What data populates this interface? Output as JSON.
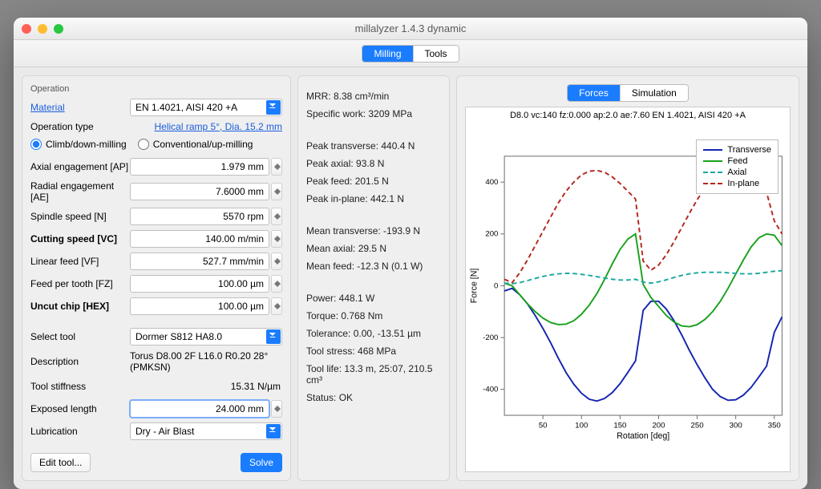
{
  "window": {
    "title": "millalyzer 1.4.3 dynamic"
  },
  "toolbar": {
    "tabs": [
      {
        "label": "Milling",
        "active": true
      },
      {
        "label": "Tools",
        "active": false
      }
    ]
  },
  "right_tabs": [
    {
      "label": "Forces",
      "active": true
    },
    {
      "label": "Simulation",
      "active": false
    }
  ],
  "operation": {
    "section_label": "Operation",
    "material_label": "Material",
    "material_value": "EN 1.4021, AISI 420 +A",
    "op_type_label": "Operation type",
    "op_type_link": "Helical ramp 5°, Dia. 15.2 mm",
    "radio_climb": "Climb/down-milling",
    "radio_conv": "Conventional/up-milling",
    "climb_selected": true,
    "rows": {
      "ap": {
        "label": "Axial engagement [AP]",
        "value": "1.979 mm"
      },
      "ae": {
        "label": "Radial engagement [AE]",
        "value": "7.6000 mm"
      },
      "n": {
        "label": "Spindle speed [N]",
        "value": "5570 rpm"
      },
      "vc": {
        "label": "Cutting speed [VC]",
        "value": "140.00 m/min",
        "bold": true
      },
      "vf": {
        "label": "Linear feed [VF]",
        "value": "527.7 mm/min"
      },
      "fz": {
        "label": "Feed per tooth [FZ]",
        "value": "100.00 µm"
      },
      "hex": {
        "label": "Uncut chip [HEX]",
        "value": "100.00 µm",
        "bold": true
      }
    },
    "tool": {
      "select_label": "Select tool",
      "select_value": "Dormer S812 HA8.0",
      "desc_label": "Description",
      "desc_value": "Torus D8.00 2F L16.0 R0.20 28° (PMKSN)",
      "stiff_label": "Tool stiffness",
      "stiff_value": "15.31 N/µm",
      "exposed_label": "Exposed length",
      "exposed_value": "24.000 mm",
      "lub_label": "Lubrication",
      "lub_value": "Dry - Air Blast"
    },
    "edit_tool_label": "Edit tool...",
    "solve_label": "Solve"
  },
  "results": [
    "MRR: 8.38 cm³/min",
    "Specific work: 3209 MPa",
    "",
    "Peak transverse: 440.4 N",
    "Peak axial: 93.8 N",
    "Peak feed: 201.5 N",
    "Peak in-plane: 442.1 N",
    "",
    "Mean transverse: -193.9 N",
    "Mean axial: 29.5 N",
    "Mean feed: -12.3 N (0.1 W)",
    "",
    "Power: 448.1 W",
    "Torque: 0.768 Nm",
    "Tolerance: 0.00, -13.51 µm",
    "Tool stress: 468 MPa",
    "Tool life: 13.3 m, 25:07, 210.5 cm³",
    "Status: OK"
  ],
  "chart_data": {
    "type": "line",
    "title": "D8.0 vc:140 fz:0.000 ap:2.0 ae:7.60 EN 1.4021, AISI 420 +A",
    "xlabel": "Rotation [deg]",
    "ylabel": "Force [N]",
    "xlim": [
      0,
      360
    ],
    "ylim": [
      -500,
      500
    ],
    "xticks": [
      50,
      100,
      150,
      200,
      250,
      300,
      350
    ],
    "yticks": [
      -400,
      -200,
      0,
      200,
      400
    ],
    "legend": [
      "Transverse",
      "Feed",
      "Axial",
      "In-plane"
    ],
    "legend_pos": "top-right",
    "series": [
      {
        "name": "Transverse",
        "color": "#1524b0",
        "dash": "",
        "x": [
          0,
          10,
          20,
          30,
          40,
          50,
          60,
          70,
          80,
          90,
          100,
          110,
          120,
          130,
          140,
          150,
          160,
          170,
          180,
          190,
          200,
          210,
          220,
          230,
          240,
          250,
          260,
          270,
          280,
          290,
          300,
          310,
          320,
          330,
          340,
          350,
          360
        ],
        "y": [
          -20,
          -10,
          -35,
          -70,
          -115,
          -165,
          -220,
          -280,
          -335,
          -380,
          -415,
          -438,
          -445,
          -435,
          -412,
          -378,
          -335,
          -290,
          -95,
          -60,
          -60,
          -90,
          -135,
          -190,
          -250,
          -305,
          -355,
          -400,
          -428,
          -442,
          -440,
          -422,
          -392,
          -352,
          -310,
          -180,
          -120
        ]
      },
      {
        "name": "Feed",
        "color": "#18a11b",
        "dash": "",
        "x": [
          0,
          10,
          20,
          30,
          40,
          50,
          60,
          70,
          80,
          90,
          100,
          110,
          120,
          130,
          140,
          150,
          160,
          170,
          180,
          190,
          200,
          210,
          220,
          230,
          240,
          250,
          260,
          270,
          280,
          290,
          300,
          310,
          320,
          330,
          340,
          350,
          360
        ],
        "y": [
          10,
          0,
          -35,
          -70,
          -100,
          -125,
          -142,
          -150,
          -148,
          -135,
          -110,
          -75,
          -30,
          25,
          85,
          140,
          180,
          200,
          5,
          -45,
          -80,
          -115,
          -140,
          -155,
          -158,
          -150,
          -130,
          -100,
          -60,
          -10,
          45,
          100,
          150,
          185,
          200,
          195,
          155
        ]
      },
      {
        "name": "Axial",
        "color": "#1aa7a0",
        "dash": "6,4",
        "x": [
          0,
          10,
          20,
          30,
          40,
          50,
          60,
          70,
          80,
          90,
          100,
          110,
          120,
          130,
          140,
          150,
          160,
          170,
          180,
          190,
          200,
          210,
          220,
          230,
          240,
          250,
          260,
          270,
          280,
          290,
          300,
          310,
          320,
          330,
          340,
          350,
          360
        ],
        "y": [
          10,
          8,
          12,
          20,
          28,
          36,
          42,
          46,
          48,
          47,
          44,
          40,
          35,
          30,
          25,
          22,
          22,
          25,
          14,
          10,
          15,
          23,
          32,
          40,
          46,
          50,
          52,
          52,
          52,
          50,
          48,
          46,
          46,
          48,
          52,
          56,
          58
        ]
      },
      {
        "name": "In-plane",
        "color": "#b4261e",
        "dash": "6,4",
        "x": [
          0,
          10,
          20,
          30,
          40,
          50,
          60,
          70,
          80,
          90,
          100,
          110,
          120,
          130,
          140,
          150,
          160,
          170,
          180,
          190,
          200,
          210,
          220,
          230,
          240,
          250,
          260,
          270,
          280,
          290,
          300,
          310,
          320,
          330,
          340,
          350,
          360
        ],
        "y": [
          25,
          12,
          50,
          100,
          155,
          210,
          265,
          320,
          365,
          400,
          428,
          442,
          445,
          438,
          420,
          395,
          365,
          335,
          95,
          60,
          80,
          120,
          170,
          225,
          280,
          332,
          378,
          412,
          435,
          445,
          442,
          430,
          410,
          385,
          360,
          250,
          200
        ]
      }
    ]
  }
}
